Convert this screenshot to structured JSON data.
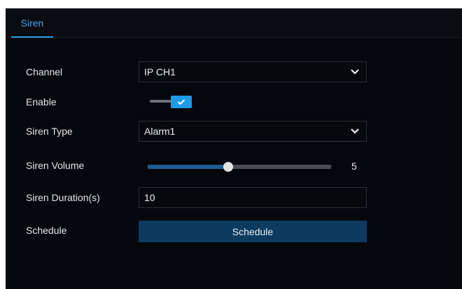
{
  "tabs": [
    {
      "label": "Siren",
      "active": true
    }
  ],
  "form": {
    "channel": {
      "label": "Channel",
      "value": "IP CH1"
    },
    "enable": {
      "label": "Enable",
      "checked": true
    },
    "siren_type": {
      "label": "Siren Type",
      "value": "Alarm1"
    },
    "siren_volume": {
      "label": "Siren Volume",
      "value": "5",
      "level_fraction": 0.44
    },
    "siren_duration": {
      "label": "Siren Duration(s)",
      "value": "10"
    },
    "schedule": {
      "label": "Schedule",
      "button_label": "Schedule"
    }
  },
  "colors": {
    "accent": "#2a9be6",
    "button": "#0d3a5f",
    "background": "#05070d"
  },
  "icons": {
    "dropdown": "chevron-down-icon",
    "check": "check-icon"
  }
}
